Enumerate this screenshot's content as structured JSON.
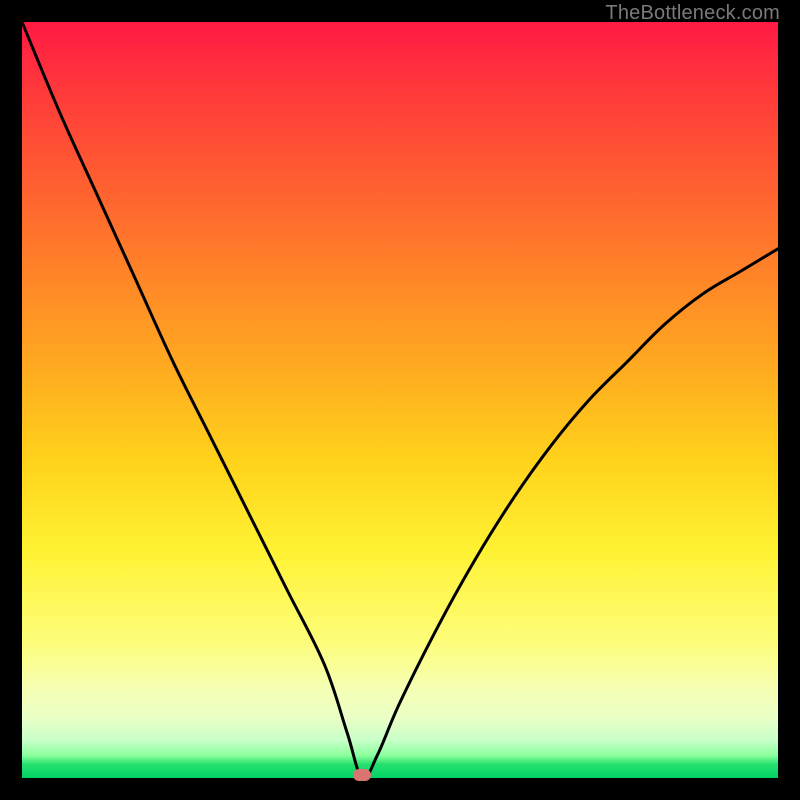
{
  "watermark": "TheBottleneck.com",
  "colors": {
    "frame": "#000000",
    "curve": "#000000",
    "marker": "#d9746f"
  },
  "chart_data": {
    "type": "line",
    "title": "",
    "xlabel": "",
    "ylabel": "",
    "xlim": [
      0,
      100
    ],
    "ylim": [
      0,
      100
    ],
    "x": [
      0,
      5,
      10,
      15,
      20,
      25,
      30,
      35,
      40,
      43,
      45,
      47,
      50,
      55,
      60,
      65,
      70,
      75,
      80,
      85,
      90,
      95,
      100
    ],
    "values": [
      100,
      88,
      77,
      66,
      55,
      45,
      35,
      25,
      15,
      6,
      0,
      3,
      10,
      20,
      29,
      37,
      44,
      50,
      55,
      60,
      64,
      67,
      70
    ],
    "marker": {
      "x": 45,
      "y": 0
    },
    "grid": false,
    "legend": false
  }
}
